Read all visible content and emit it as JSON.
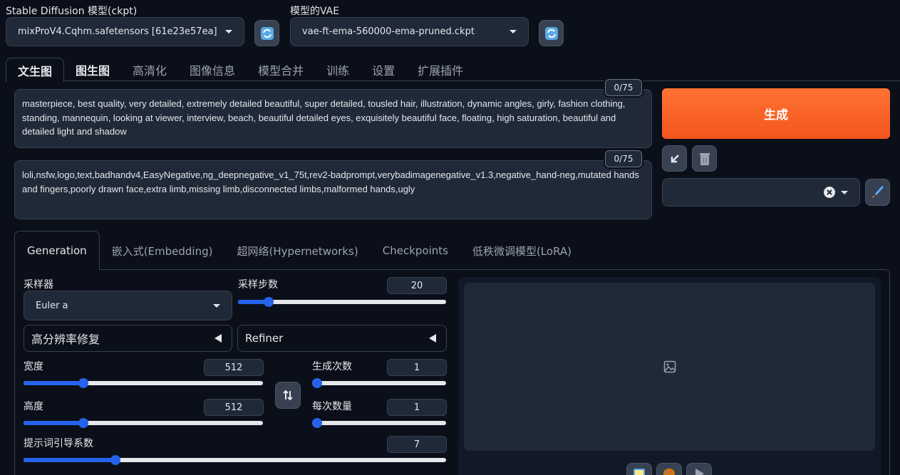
{
  "models": {
    "sd_label": "Stable Diffusion 模型(ckpt)",
    "sd_value": "mixProV4.Cqhm.safetensors [61e23e57ea]",
    "vae_label": "模型的VAE",
    "vae_value": "vae-ft-ema-560000-ema-pruned.ckpt"
  },
  "tabs": [
    "文生图",
    "图生图",
    "高清化",
    "图像信息",
    "模型合并",
    "训练",
    "设置",
    "扩展插件"
  ],
  "prompt": {
    "counter": "0/75",
    "text": "masterpiece, best quality, very detailed, extremely detailed beautiful, super detailed, tousled hair, illustration, dynamic angles, girly, fashion clothing, standing, mannequin, looking at viewer, interview, beach, beautiful detailed eyes, exquisitely beautiful face, floating, high saturation, beautiful and detailed light and shadow"
  },
  "negative_prompt": {
    "counter": "0/75",
    "text": "loli,nsfw,logo,text,badhandv4,EasyNegative,ng_deepnegative_v1_75t,rev2-badprompt,verybadimagenegative_v1.3,negative_hand-neg,mutated hands and fingers,poorly drawn face,extra limb,missing limb,disconnected limbs,malformed hands,ugly"
  },
  "generate_label": "生成",
  "styles_value": "",
  "subtabs": [
    "Generation",
    "嵌入式(Embedding)",
    "超网络(Hypernetworks)",
    "Checkpoints",
    "低秩微调模型(LoRA)"
  ],
  "generation": {
    "sampler_label": "采样器",
    "sampler_value": "Euler a",
    "steps_label": "采样步数",
    "steps_value": "20",
    "steps_fraction": 0.13,
    "hires_label": "高分辨率修复",
    "refiner_label": "Refiner",
    "width_label": "宽度",
    "width_value": "512",
    "width_fraction": 0.24,
    "height_label": "高度",
    "height_value": "512",
    "height_fraction": 0.24,
    "batch_count_label": "生成次数",
    "batch_count_value": "1",
    "batch_count_fraction": 0.0,
    "batch_size_label": "每次数量",
    "batch_size_value": "1",
    "batch_size_fraction": 0.0,
    "cfg_label": "提示词引导系数",
    "cfg_value": "7",
    "cfg_fraction": 0.21
  },
  "colors": {
    "accent": "#2563eb",
    "generate": "#f3561c",
    "background": "#0b0f19"
  }
}
